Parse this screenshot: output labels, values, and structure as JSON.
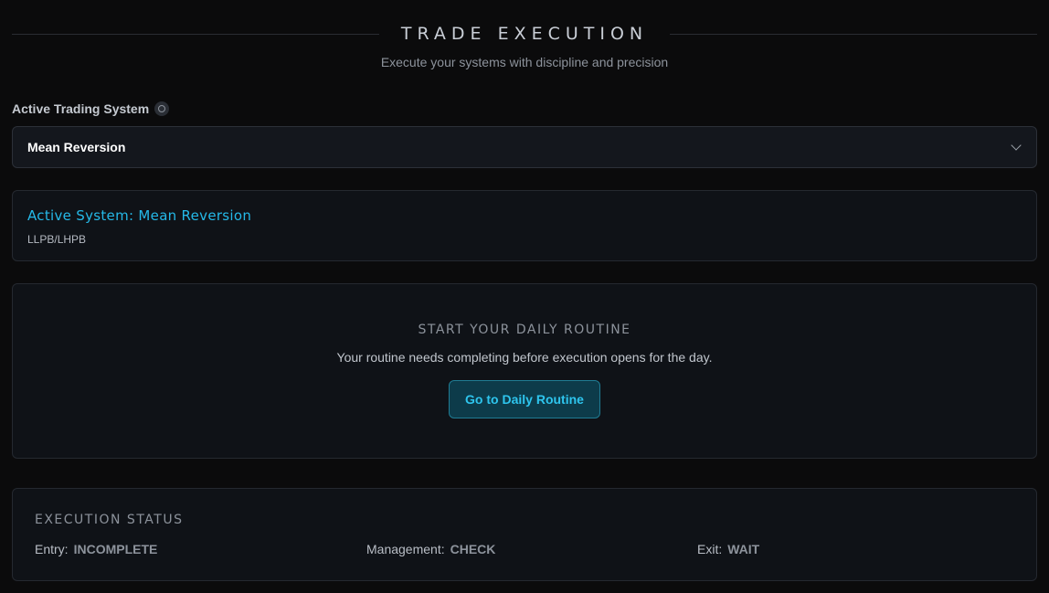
{
  "header": {
    "title": "TRADE EXECUTION",
    "subtitle": "Execute your systems with discipline and precision"
  },
  "system_select": {
    "label": "Active Trading System",
    "value": "Mean Reversion"
  },
  "active_system": {
    "title": "Active System: Mean Reversion",
    "description": "LLPB/LHPB"
  },
  "routine": {
    "title": "START YOUR DAILY ROUTINE",
    "message": "Your routine needs completing before execution opens for the day.",
    "button_label": "Go to Daily Routine"
  },
  "execution_status": {
    "title": "EXECUTION STATUS",
    "items": [
      {
        "label": "Entry:",
        "value": "INCOMPLETE"
      },
      {
        "label": "Management:",
        "value": "CHECK"
      },
      {
        "label": "Exit:",
        "value": "WAIT"
      }
    ]
  },
  "colors": {
    "accent": "#25b9e8",
    "background": "#0b0b0c",
    "card": "#0f1217"
  }
}
